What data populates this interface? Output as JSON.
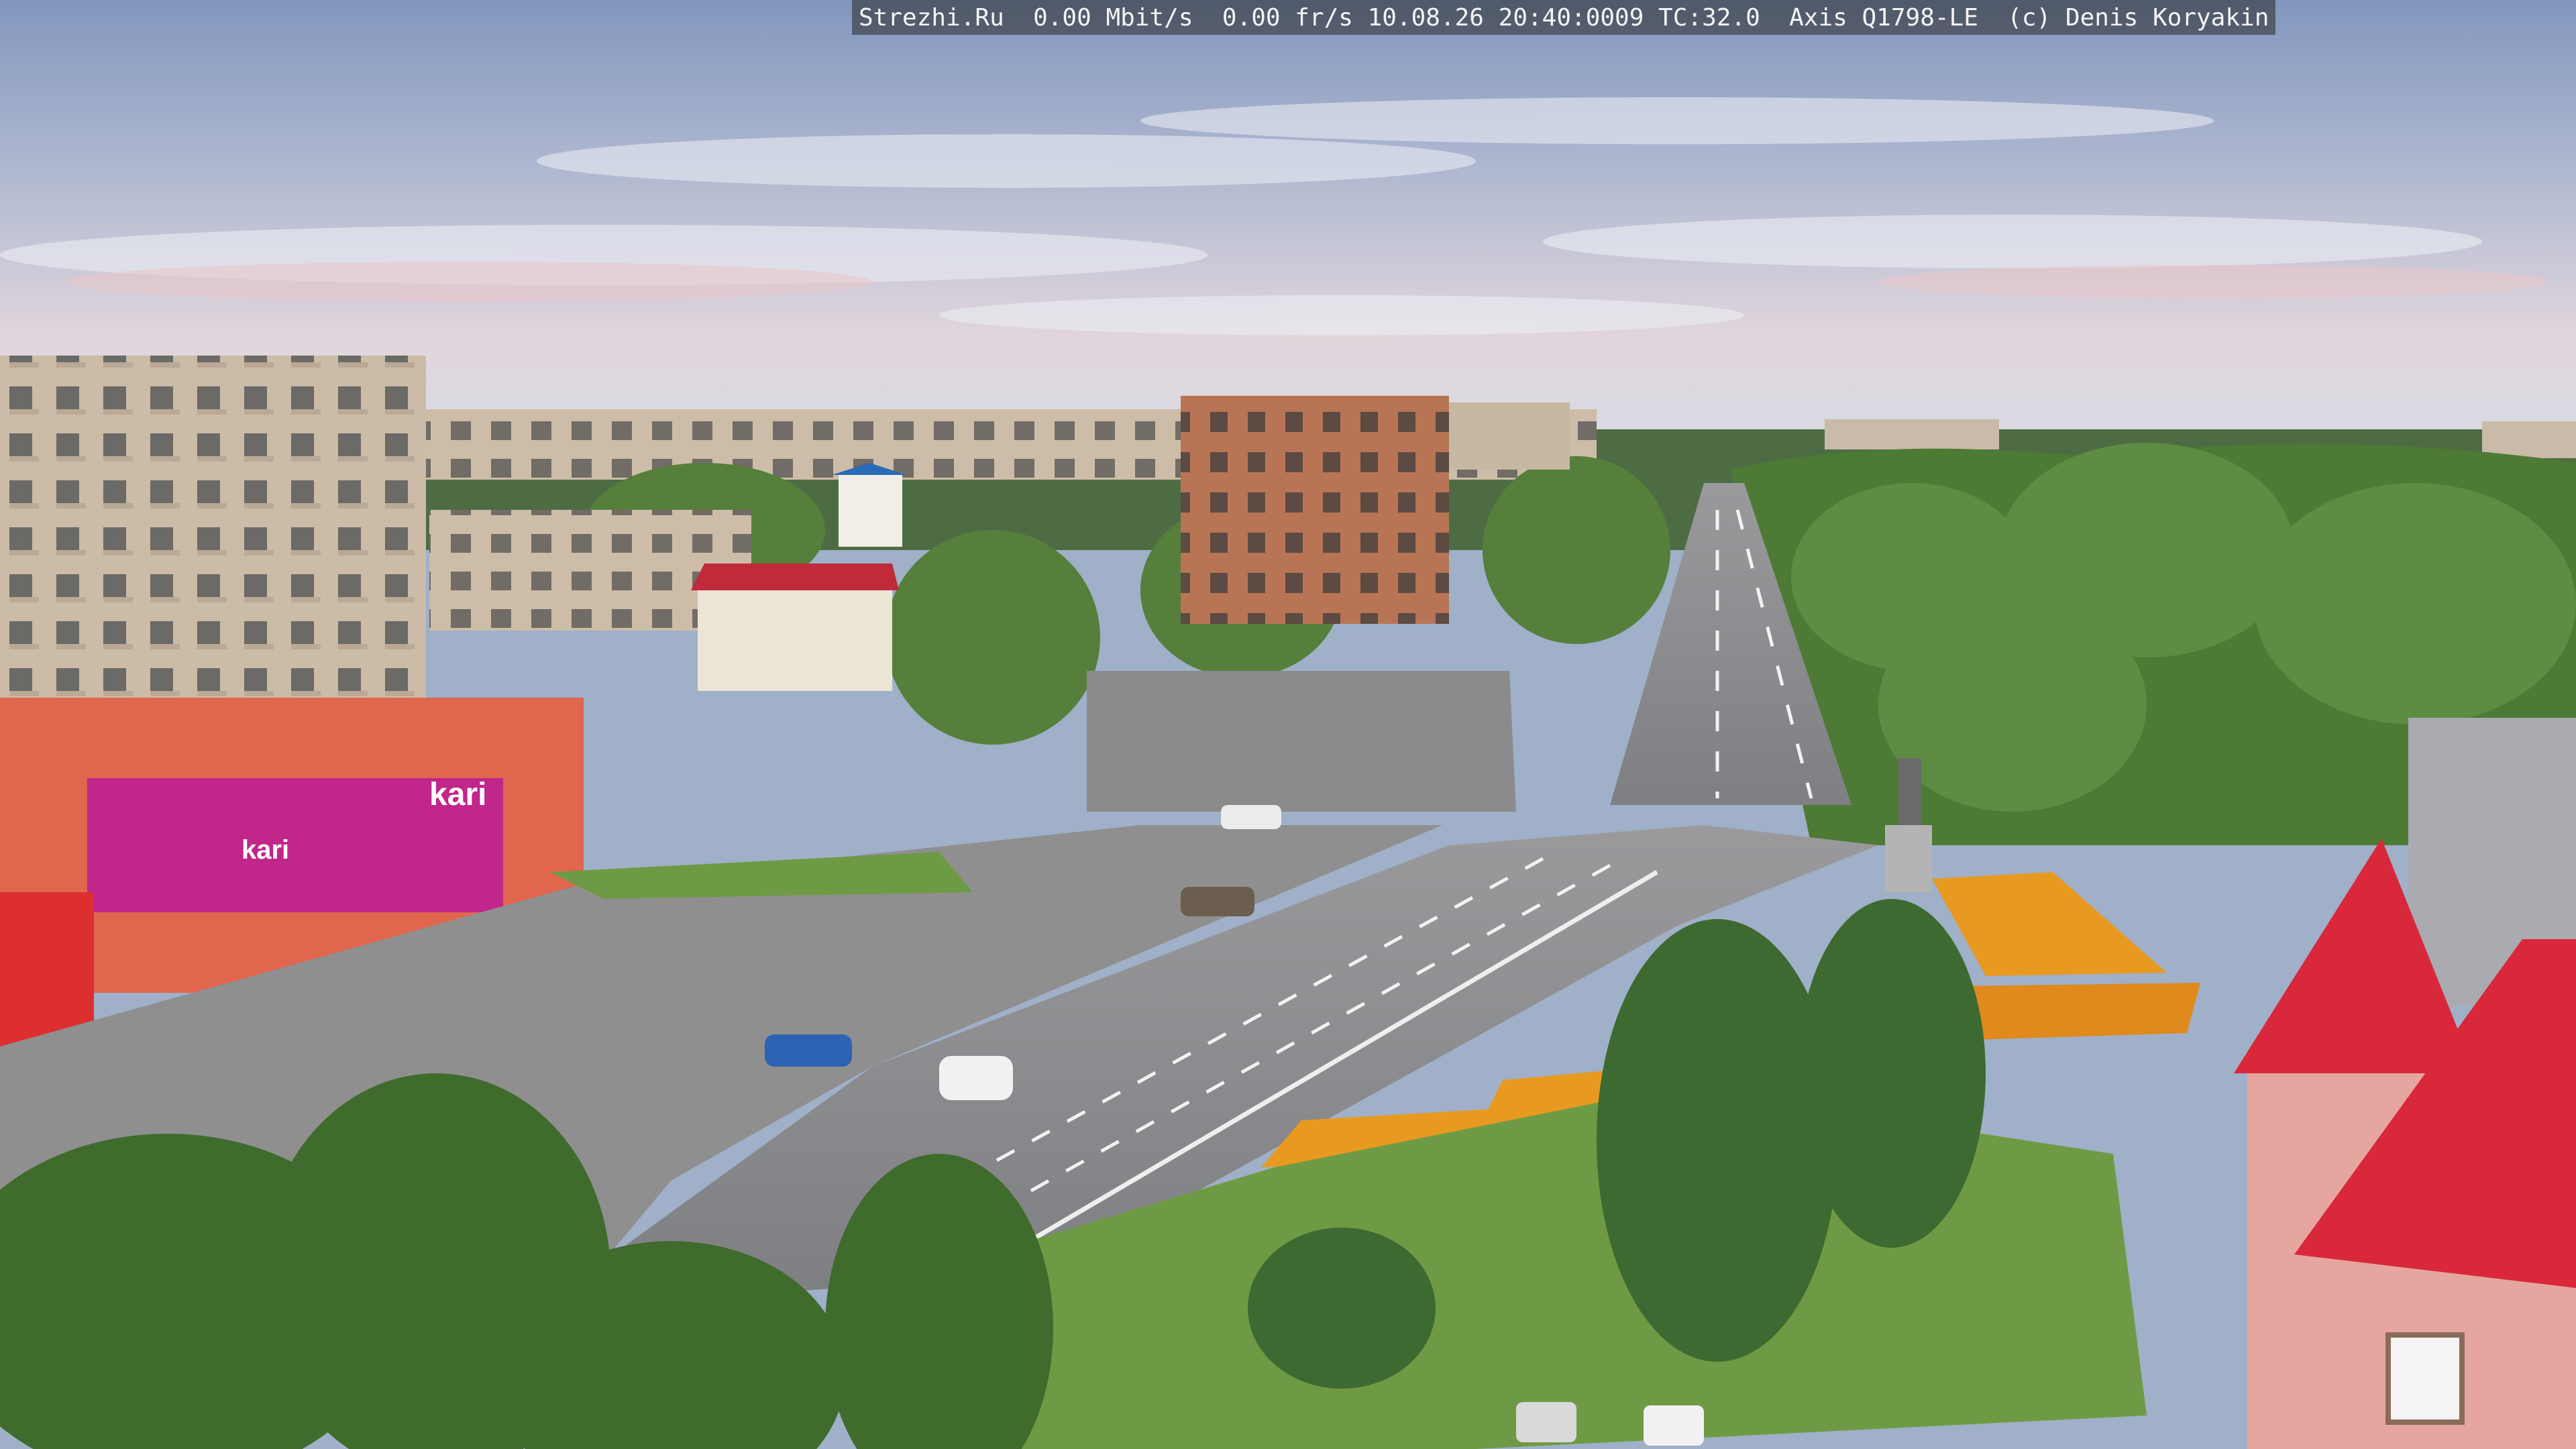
{
  "overlay": {
    "text": "Strezhi.Ru  0.00 Mbit/s  0.00 fr/s 10.08.26 20:40:0009 TC:32.0  Axis Q1798-LE  (c) Denis Koryakin"
  },
  "signs": {
    "store_main": "kari",
    "store_banner": "kari"
  },
  "palette": {
    "sky_top": "#8d9fc2",
    "sky_bottom": "#d9dbe6",
    "building_panel": "#c9b9a6",
    "building_brick": "#b8735a",
    "store_red": "#e0543a",
    "store_magenta": "#c1268a",
    "roof_red": "#d8283a",
    "asphalt": "#8c8c8e",
    "trees": "#4f7a3a",
    "grass": "#6f9a45",
    "flowers": "#e89a20"
  }
}
